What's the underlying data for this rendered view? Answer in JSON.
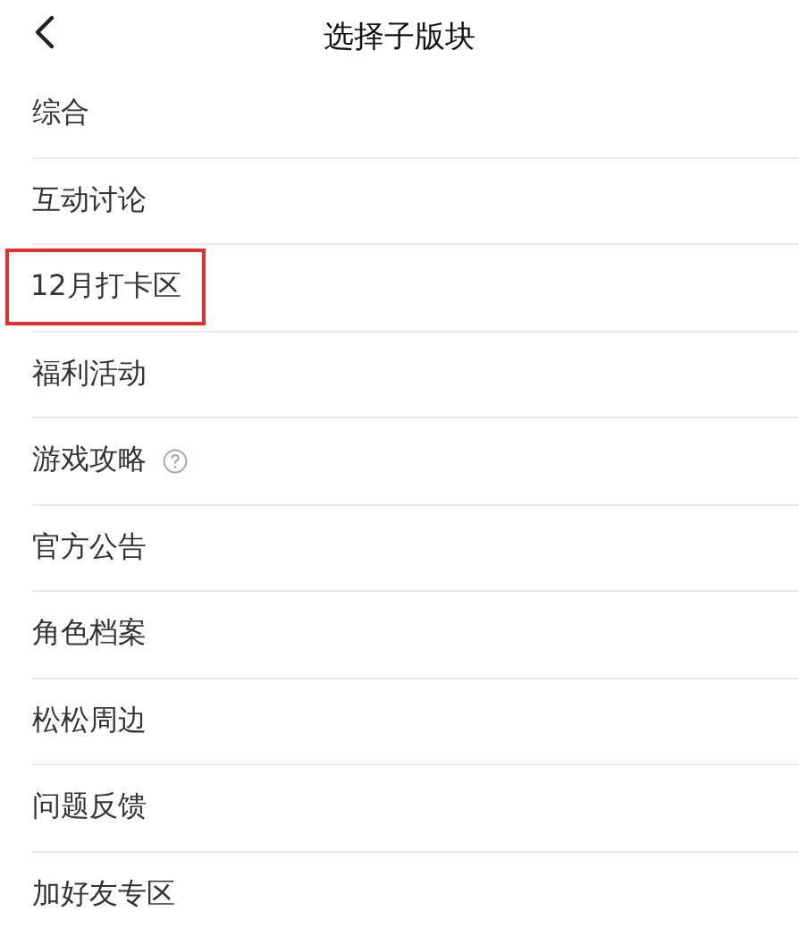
{
  "header": {
    "title": "选择子版块"
  },
  "items": [
    {
      "label": "综合",
      "highlighted": false,
      "help_icon": false
    },
    {
      "label": "互动讨论",
      "highlighted": false,
      "help_icon": false
    },
    {
      "label": "12月打卡区",
      "highlighted": true,
      "help_icon": false
    },
    {
      "label": "福利活动",
      "highlighted": false,
      "help_icon": false
    },
    {
      "label": "游戏攻略",
      "highlighted": false,
      "help_icon": true
    },
    {
      "label": "官方公告",
      "highlighted": false,
      "help_icon": false
    },
    {
      "label": "角色档案",
      "highlighted": false,
      "help_icon": false
    },
    {
      "label": "松松周边",
      "highlighted": false,
      "help_icon": false
    },
    {
      "label": "问题反馈",
      "highlighted": false,
      "help_icon": false
    },
    {
      "label": "加好友专区",
      "highlighted": false,
      "help_icon": false
    }
  ]
}
